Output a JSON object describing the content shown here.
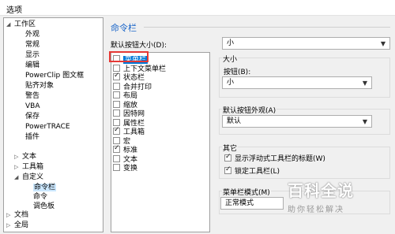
{
  "window": {
    "title": "选项"
  },
  "tree": {
    "root": "工作区",
    "workspace_children": [
      "外观",
      "常规",
      "显示",
      "编辑",
      "PowerClip 图文框",
      "贴齐对象",
      "警告",
      "VBA",
      "保存",
      "PowerTRACE",
      "插件"
    ],
    "text": "文本",
    "toolbox": "工具箱",
    "customize": "自定义",
    "customize_children": [
      "命令栏",
      "命令",
      "调色板"
    ],
    "document": "文档",
    "global": "全局"
  },
  "panel": {
    "title": "命令栏",
    "default_button_size_label": "默认按钮大小(D):",
    "default_button_size_value": "小"
  },
  "menu_list": [
    {
      "label": "菜单栏",
      "checked": false,
      "selected": true
    },
    {
      "label": "上下文菜单栏",
      "checked": false
    },
    {
      "label": "状态栏",
      "checked": true
    },
    {
      "label": "合并打印",
      "checked": false
    },
    {
      "label": "布局",
      "checked": false
    },
    {
      "label": "缩放",
      "checked": false
    },
    {
      "label": "因特网",
      "checked": false
    },
    {
      "label": "属性栏",
      "checked": false
    },
    {
      "label": "工具箱",
      "checked": true
    },
    {
      "label": "宏",
      "checked": false
    },
    {
      "label": "标准",
      "checked": true
    },
    {
      "label": "文本",
      "checked": false
    },
    {
      "label": "变换",
      "checked": false
    }
  ],
  "size_group": {
    "title": "大小",
    "button_label": "按钮(B):",
    "button_value": "小"
  },
  "appearance_group": {
    "title": "默认按钮外观(A)",
    "value": "默认"
  },
  "other_group": {
    "title": "其它",
    "show_floating_title": "显示浮动式工具栏的标题(W)",
    "show_floating_title_checked": true,
    "lock_toolbar": "锁定工具栏(L)",
    "lock_toolbar_checked": true
  },
  "menubar_mode_group": {
    "title": "菜单栏模式(M)",
    "value": "正常模式"
  },
  "watermark": {
    "main": "百科全说",
    "sub": "助你轻松解决"
  }
}
